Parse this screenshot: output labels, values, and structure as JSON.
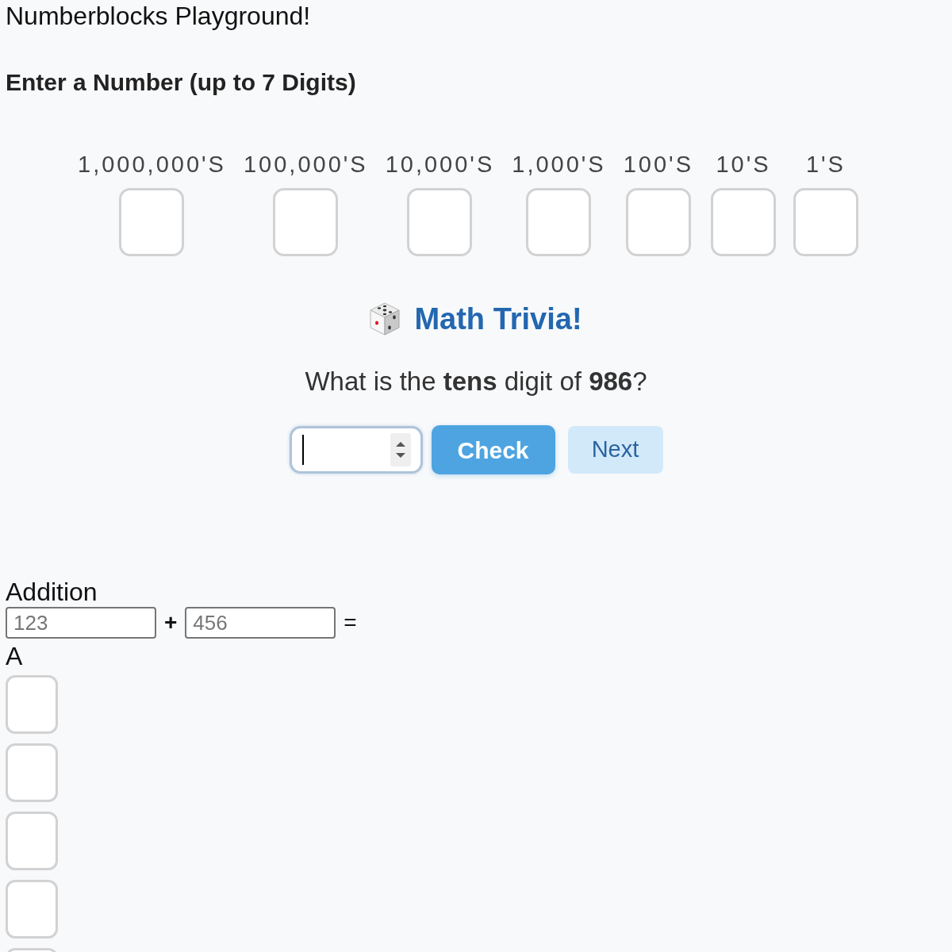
{
  "title": "Numberblocks Playground!",
  "number_entry": {
    "heading": "Enter a Number (up to 7 Digits)",
    "places": [
      {
        "label": "1,000,000'S"
      },
      {
        "label": "100,000'S"
      },
      {
        "label": "10,000'S"
      },
      {
        "label": "1,000'S"
      },
      {
        "label": "100'S"
      },
      {
        "label": "10'S"
      },
      {
        "label": "1'S"
      }
    ]
  },
  "trivia": {
    "title": "Math Trivia!",
    "question": "What is the **tens** digit of **986**?",
    "answer_field": {
      "focused": true
    },
    "buttons": [
      {
        "label": "Check",
        "kind": "primary"
      },
      {
        "label": "Next",
        "kind": "secondary"
      }
    ]
  },
  "addition": {
    "title": "Addition",
    "fields": [
      {
        "placeholder": "123"
      },
      {
        "placeholder": "456"
      }
    ],
    "operator": "+",
    "equals": "=",
    "answer_label": "A",
    "answer_boxes": [
      {
        "kind": "digit"
      },
      {
        "kind": "digit"
      },
      {
        "kind": "digit"
      },
      {
        "kind": "digit"
      },
      {
        "kind": "digit"
      }
    ]
  }
}
